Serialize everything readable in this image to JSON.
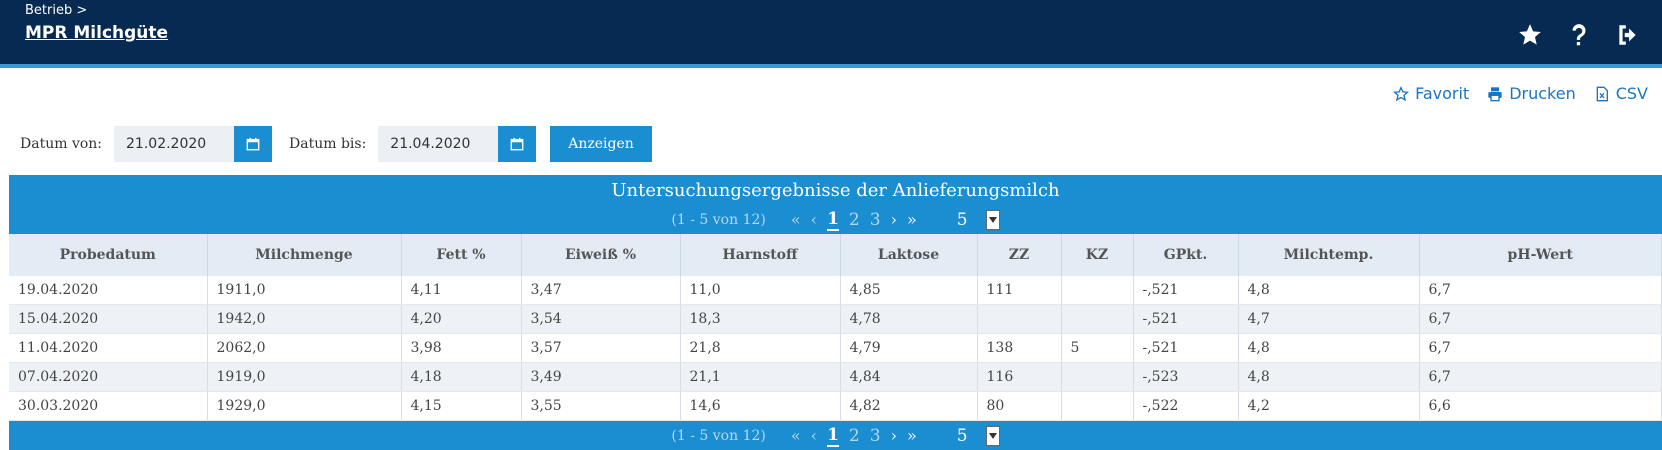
{
  "header": {
    "breadcrumb": "Betrieb >",
    "title": "MPR Milchgüte",
    "icons": [
      "star-icon",
      "help-icon",
      "logout-icon"
    ]
  },
  "actions": {
    "favorite": "Favorit",
    "print": "Drucken",
    "csv": "CSV"
  },
  "filter": {
    "from_label": "Datum von:",
    "from_value": "21.02.2020",
    "to_label": "Datum bis:",
    "to_value": "21.04.2020",
    "show_button": "Anzeigen"
  },
  "table": {
    "caption": "Untersuchungsergebnisse der Anlieferungsmilch",
    "pager": {
      "info": "(1 - 5 von 12)",
      "pages": [
        "1",
        "2",
        "3"
      ],
      "current_page": "1",
      "page_size": "5"
    },
    "columns": [
      "Probedatum",
      "Milchmenge",
      "Fett %",
      "Eiweiß %",
      "Harnstoff",
      "Laktose",
      "ZZ",
      "KZ",
      "GPkt.",
      "Milchtemp.",
      "pH-Wert"
    ],
    "rows": [
      [
        "19.04.2020",
        "1911,0",
        "4,11",
        "3,47",
        "11,0",
        "4,85",
        "111",
        "",
        "-,521",
        "4,8",
        "6,7"
      ],
      [
        "15.04.2020",
        "1942,0",
        "4,20",
        "3,54",
        "18,3",
        "4,78",
        "",
        "",
        "-,521",
        "4,7",
        "6,7"
      ],
      [
        "11.04.2020",
        "2062,0",
        "3,98",
        "3,57",
        "21,8",
        "4,79",
        "138",
        "5",
        "-,521",
        "4,8",
        "6,7"
      ],
      [
        "07.04.2020",
        "1919,0",
        "4,18",
        "3,49",
        "21,1",
        "4,84",
        "116",
        "",
        "-,523",
        "4,8",
        "6,7"
      ],
      [
        "30.03.2020",
        "1929,0",
        "4,15",
        "3,55",
        "14,6",
        "4,82",
        "80",
        "",
        "-,522",
        "4,2",
        "6,6"
      ]
    ]
  },
  "colors": {
    "header_bg": "#062a52",
    "accent": "#1a8ed1",
    "link": "#1a75c4"
  }
}
